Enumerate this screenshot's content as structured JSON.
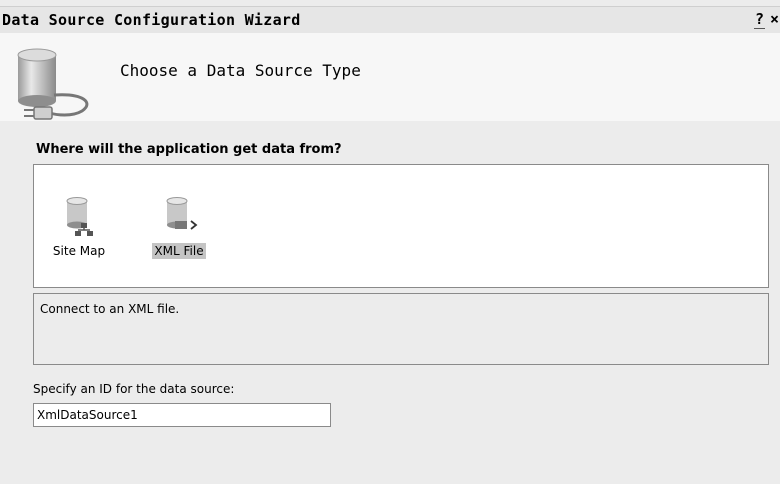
{
  "window": {
    "title": "Data Source Configuration Wizard",
    "help_glyph": "?",
    "close_glyph": "×"
  },
  "header": {
    "title": "Choose a Data Source Type",
    "icon": "database-plug-icon"
  },
  "source_types": {
    "question": "Where will the application get data from?",
    "items": [
      {
        "label": "Site Map",
        "icon": "site-map-database-icon",
        "selected": false
      },
      {
        "label": "XML File",
        "icon": "xml-file-database-icon",
        "selected": true
      }
    ]
  },
  "description": {
    "text": "Connect to an XML file."
  },
  "id_field": {
    "label": "Specify an ID for the data source:",
    "value": "XmlDataSource1"
  }
}
